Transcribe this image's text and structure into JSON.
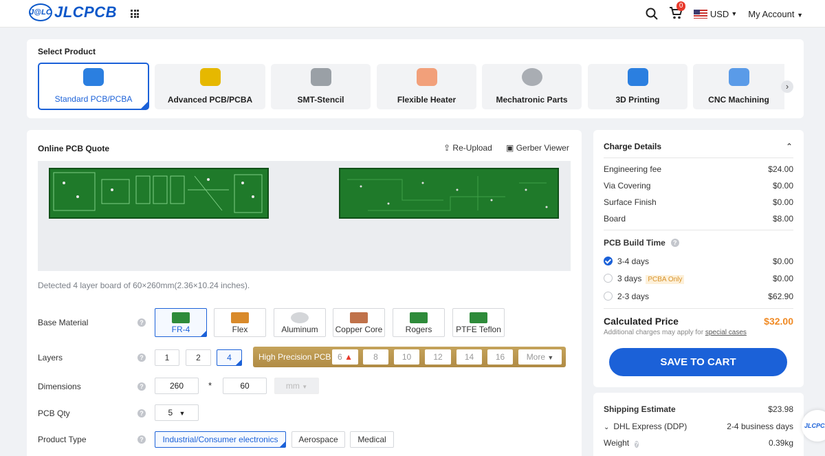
{
  "header": {
    "logo_badge": "J@LC",
    "logo_text": "JLCPCB",
    "cart_count": "0",
    "currency": "USD",
    "account": "My Account"
  },
  "select_product": {
    "title": "Select Product",
    "items": [
      {
        "label": "Standard PCB/PCBA",
        "icon": "pcb-chip-icon",
        "color": "#2b7fe0"
      },
      {
        "label": "Advanced PCB/PCBA",
        "icon": "pcb-gold-chip-icon",
        "color": "#e6b800"
      },
      {
        "label": "SMT-Stencil",
        "icon": "stencil-icon",
        "color": "#9aa0a6"
      },
      {
        "label": "Flexible Heater",
        "icon": "heater-icon",
        "color": "#f2a07a"
      },
      {
        "label": "Mechatronic Parts",
        "icon": "nut-icon",
        "color": "#a9adb3"
      },
      {
        "label": "3D Printing",
        "icon": "3d-print-icon",
        "color": "#2b7fe0"
      },
      {
        "label": "CNC Machining",
        "icon": "cnc-icon",
        "color": "#5a9be8"
      }
    ]
  },
  "quote": {
    "title": "Online PCB Quote",
    "reupload": "Re-Upload",
    "gerber": "Gerber Viewer",
    "detected": "Detected 4 layer board of 60×260mm(2.36×10.24 inches).",
    "base_material": {
      "label": "Base Material",
      "options": [
        "FR-4",
        "Flex",
        "Aluminum",
        "Copper Core",
        "Rogers",
        "PTFE Teflon"
      ]
    },
    "layers": {
      "label": "Layers",
      "options": [
        "1",
        "2",
        "4"
      ],
      "high_precision_label": "High Precision PCB",
      "high_precision_options": [
        "6",
        "8",
        "10",
        "12",
        "14",
        "16"
      ],
      "more": "More"
    },
    "dimensions": {
      "label": "Dimensions",
      "width": "260",
      "height": "60",
      "sep": "*",
      "unit": "mm"
    },
    "qty": {
      "label": "PCB Qty",
      "value": "5"
    },
    "product_type": {
      "label": "Product Type",
      "options": [
        "Industrial/Consumer electronics",
        "Aerospace",
        "Medical"
      ]
    }
  },
  "charges": {
    "title": "Charge Details",
    "items": [
      {
        "label": "Engineering fee",
        "value": "$24.00"
      },
      {
        "label": "Via Covering",
        "value": "$0.00"
      },
      {
        "label": "Surface Finish",
        "value": "$0.00"
      },
      {
        "label": "Board",
        "value": "$8.00"
      }
    ],
    "build_time_title": "PCB Build Time",
    "build_times": [
      {
        "label": "3-4 days",
        "value": "$0.00",
        "selected": true
      },
      {
        "label": "3 days",
        "value": "$0.00",
        "tag": "PCBA Only"
      },
      {
        "label": "2-3 days",
        "value": "$62.90"
      }
    ],
    "calc_label": "Calculated Price",
    "calc_value": "$32.00",
    "additional": "Additional charges may apply for",
    "special": "special cases",
    "save": "SAVE TO CART"
  },
  "shipping": {
    "title": "Shipping Estimate",
    "value": "$23.98",
    "method": "DHL Express (DDP)",
    "days": "2-4 business days",
    "weight_label": "Weight",
    "weight": "0.39kg"
  },
  "float_badge": "JLCPCB"
}
